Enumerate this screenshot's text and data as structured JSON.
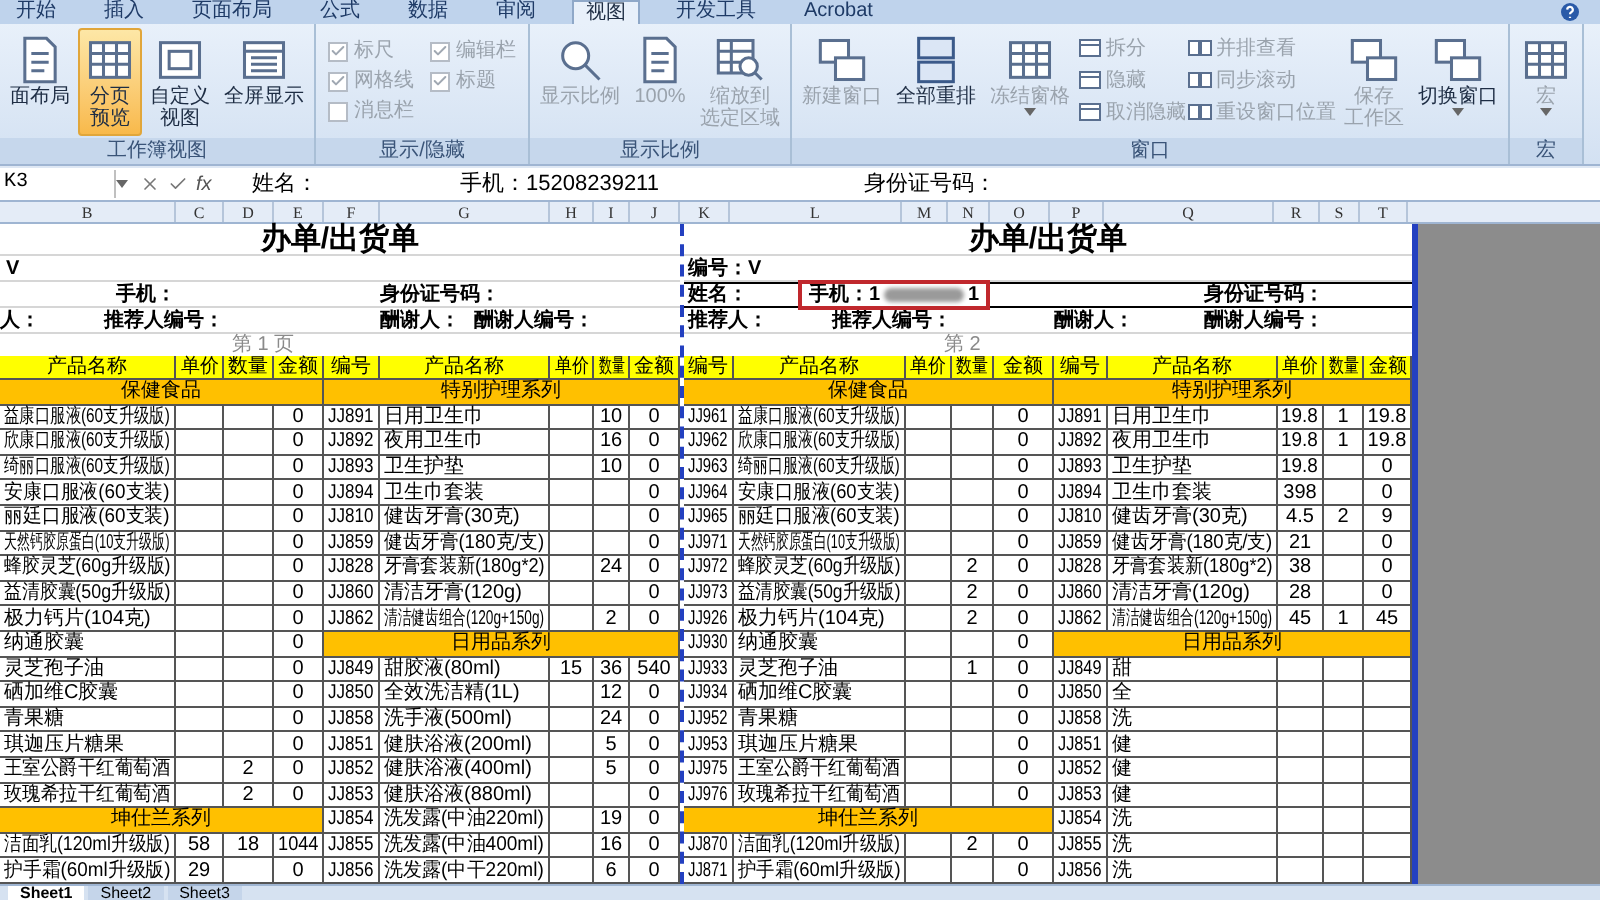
{
  "ribbon": {
    "tabs": [
      {
        "label": "开始",
        "selected": false
      },
      {
        "label": "插入",
        "selected": false
      },
      {
        "label": "页面布局",
        "selected": false
      },
      {
        "label": "公式",
        "selected": false
      },
      {
        "label": "数据",
        "selected": false
      },
      {
        "label": "审阅",
        "selected": false
      },
      {
        "label": "视图",
        "selected": true
      },
      {
        "label": "开发工具",
        "selected": false
      },
      {
        "label": "Acrobat",
        "selected": false
      }
    ],
    "groups": [
      {
        "label": "工作簿视图",
        "items": [
          {
            "kind": "large",
            "lines": [
              "面布局"
            ],
            "selected": false,
            "disabled": false,
            "dropdown": false
          },
          {
            "kind": "large",
            "lines": [
              "分页",
              "预览"
            ],
            "selected": true,
            "disabled": false,
            "dropdown": false
          },
          {
            "kind": "large",
            "lines": [
              "自定义",
              "视图"
            ],
            "selected": false,
            "disabled": false,
            "dropdown": false
          },
          {
            "kind": "large",
            "lines": [
              "全屏显示"
            ],
            "selected": false,
            "disabled": false,
            "dropdown": false
          }
        ]
      },
      {
        "label": "显示/隐藏",
        "items": [
          {
            "kind": "check",
            "label": "标尺",
            "checked": true,
            "disabled": true
          },
          {
            "kind": "check",
            "label": "编辑栏",
            "checked": true,
            "disabled": true
          },
          {
            "kind": "check",
            "label": "网格线",
            "checked": true,
            "disabled": true
          },
          {
            "kind": "check",
            "label": "标题",
            "checked": true,
            "disabled": true
          },
          {
            "kind": "check",
            "label": "消息栏",
            "checked": false,
            "disabled": true
          }
        ]
      },
      {
        "label": "显示比例",
        "items": [
          {
            "kind": "large",
            "lines": [
              "显示比例"
            ],
            "disabled": true,
            "dropdown": false
          },
          {
            "kind": "large",
            "lines": [
              "100%"
            ],
            "disabled": true,
            "dropdown": false
          },
          {
            "kind": "large",
            "lines": [
              "缩放到",
              "选定区域"
            ],
            "disabled": true,
            "dropdown": false
          }
        ]
      },
      {
        "label": "窗口",
        "items": [
          {
            "kind": "large",
            "lines": [
              "新建窗口"
            ],
            "disabled": true,
            "dropdown": false
          },
          {
            "kind": "large",
            "lines": [
              "全部重排"
            ],
            "disabled": false,
            "dropdown": false
          },
          {
            "kind": "large",
            "lines": [
              "冻结窗格"
            ],
            "disabled": true,
            "dropdown": true
          },
          {
            "kind": "small",
            "label": "拆分",
            "disabled": true
          },
          {
            "kind": "small",
            "label": "隐藏",
            "disabled": true
          },
          {
            "kind": "small",
            "label": "取消隐藏",
            "disabled": true
          },
          {
            "kind": "small",
            "label": "并排查看",
            "disabled": true
          },
          {
            "kind": "small",
            "label": "同步滚动",
            "disabled": true
          },
          {
            "kind": "small",
            "label": "重设窗口位置",
            "disabled": true
          },
          {
            "kind": "large",
            "lines": [
              "保存",
              "工作区"
            ],
            "disabled": true,
            "dropdown": false
          },
          {
            "kind": "large",
            "lines": [
              "切换窗口"
            ],
            "disabled": false,
            "dropdown": true
          }
        ]
      },
      {
        "label": "宏",
        "items": [
          {
            "kind": "large",
            "lines": [
              "宏"
            ],
            "disabled": true,
            "dropdown": true
          }
        ]
      }
    ]
  },
  "formula_bar": {
    "name_box": "K3",
    "fx": "fx",
    "segments": [
      "姓名：",
      "手机：15208239211",
      "身份证号码："
    ]
  },
  "column_headers": [
    "B",
    "C",
    "D",
    "E",
    "F",
    "G",
    "H",
    "I",
    "J",
    "K",
    "L",
    "M",
    "N",
    "O",
    "P",
    "Q",
    "R",
    "S",
    "T"
  ],
  "pages": [
    {
      "title": "办单/出货单",
      "page_label": "第 1 页",
      "info": [
        {
          "selected": false,
          "segments": [
            {
              "kind": "text",
              "text": "V"
            }
          ]
        },
        {
          "selected": false,
          "segments": [
            {
              "kind": "text",
              "text": "手机："
            },
            {
              "kind": "text",
              "text": "身份证号码："
            }
          ]
        },
        {
          "selected": false,
          "segments": [
            {
              "kind": "text",
              "text": "人："
            },
            {
              "kind": "text",
              "text": "推荐人编号："
            },
            {
              "kind": "text",
              "text": "酬谢人："
            },
            {
              "kind": "text",
              "text": "酬谢人编号："
            }
          ]
        }
      ],
      "tables": [
        {
          "columns": [
            "产品名称",
            "单价",
            "数量",
            "金额"
          ],
          "rows": [
            {
              "kind": "category",
              "text": "保健食品"
            },
            {
              "kind": "item",
              "name": "益康口服液(60支升级版)",
              "amount": "0"
            },
            {
              "kind": "item",
              "name": "欣康口服液(60支升级版)",
              "amount": "0"
            },
            {
              "kind": "item",
              "name": "绮丽口服液(60支升级版)",
              "amount": "0"
            },
            {
              "kind": "item",
              "name": "安康口服液(60支装)",
              "amount": "0"
            },
            {
              "kind": "item",
              "name": "丽廷口服液(60支装)",
              "amount": "0"
            },
            {
              "kind": "item",
              "name": "天然钙胶原蛋白(10支升级版)",
              "amount": "0"
            },
            {
              "kind": "item",
              "name": "蜂胶灵芝(60g升级版)",
              "amount": "0"
            },
            {
              "kind": "item",
              "name": "益清胶囊(50g升级版)",
              "amount": "0"
            },
            {
              "kind": "item",
              "name": "极力钙片(104克)",
              "amount": "0"
            },
            {
              "kind": "item",
              "name": "纳通胶囊",
              "amount": "0"
            },
            {
              "kind": "item",
              "name": "灵芝孢子油",
              "amount": "0"
            },
            {
              "kind": "item",
              "name": "硒加维C胶囊",
              "amount": "0"
            },
            {
              "kind": "item",
              "name": "青果糖",
              "amount": "0"
            },
            {
              "kind": "item",
              "name": "琪迦压片糖果",
              "amount": "0"
            },
            {
              "kind": "item",
              "name": "王室公爵干红葡萄酒",
              "qty": "2",
              "amount": "0"
            },
            {
              "kind": "item",
              "name": "玫瑰希拉干红葡萄酒",
              "qty": "2",
              "amount": "0"
            },
            {
              "kind": "category",
              "text": "坤仕兰系列"
            },
            {
              "kind": "item",
              "name": "洁面乳(120ml升级版)",
              "price": "58",
              "qty": "18",
              "amount": "1044"
            },
            {
              "kind": "item",
              "name": "护手霜(60ml升级版)",
              "price": "29",
              "amount": "0"
            }
          ]
        },
        {
          "columns": [
            "编号",
            "产品名称",
            "单价",
            "数量",
            "金额"
          ],
          "rows": [
            {
              "kind": "category",
              "text": "特别护理系列"
            },
            {
              "kind": "item",
              "code": "JJ891",
              "name": "日用卫生巾",
              "qty": "10",
              "amount": "0"
            },
            {
              "kind": "item",
              "code": "JJ892",
              "name": "夜用卫生巾",
              "qty": "16",
              "amount": "0"
            },
            {
              "kind": "item",
              "code": "JJ893",
              "name": "卫生护垫",
              "qty": "10",
              "amount": "0"
            },
            {
              "kind": "item",
              "code": "JJ894",
              "name": "卫生巾套装",
              "amount": "0"
            },
            {
              "kind": "item",
              "code": "JJ810",
              "name": "健齿牙膏(30克)",
              "amount": "0"
            },
            {
              "kind": "item",
              "code": "JJ859",
              "name": "健齿牙膏(180克/支)",
              "amount": "0"
            },
            {
              "kind": "item",
              "code": "JJ828",
              "name": "牙膏套装新(180g*2)",
              "qty": "24",
              "amount": "0"
            },
            {
              "kind": "item",
              "code": "JJ860",
              "name": "清洁牙膏(120g)",
              "amount": "0"
            },
            {
              "kind": "item",
              "code": "JJ862",
              "name": "清洁健齿组合(120g+150g)",
              "qty": "2",
              "amount": "0"
            },
            {
              "kind": "category",
              "text": "日用品系列"
            },
            {
              "kind": "item",
              "code": "JJ849",
              "name": "甜胶液(80ml)",
              "price": "15",
              "qty": "36",
              "amount": "540"
            },
            {
              "kind": "item",
              "code": "JJ850",
              "name": "全效洗洁精(1L)",
              "qty": "12",
              "amount": "0"
            },
            {
              "kind": "item",
              "code": "JJ858",
              "name": "洗手液(500ml)",
              "qty": "24",
              "amount": "0"
            },
            {
              "kind": "item",
              "code": "JJ851",
              "name": "健肤浴液(200ml)",
              "qty": "5",
              "amount": "0"
            },
            {
              "kind": "item",
              "code": "JJ852",
              "name": "健肤浴液(400ml)",
              "qty": "5",
              "amount": "0"
            },
            {
              "kind": "item",
              "code": "JJ853",
              "name": "健肤浴液(880ml)",
              "amount": "0"
            },
            {
              "kind": "item",
              "code": "JJ854",
              "name": "洗发露(中油220ml)",
              "qty": "19",
              "amount": "0"
            },
            {
              "kind": "item",
              "code": "JJ855",
              "name": "洗发露(中油400ml)",
              "qty": "16",
              "amount": "0"
            },
            {
              "kind": "item",
              "code": "JJ856",
              "name": "洗发露(中干220ml)",
              "qty": "6",
              "amount": "0"
            }
          ]
        }
      ]
    },
    {
      "title": "办单/出货单",
      "page_label": "第 2",
      "info": [
        {
          "selected": false,
          "segments": [
            {
              "kind": "text",
              "text": "编号：V"
            }
          ]
        },
        {
          "selected": true,
          "segments": [
            {
              "kind": "text",
              "text": "姓名："
            },
            {
              "kind": "masked",
              "before": "手机：1",
              "after": "1",
              "highlighted": true
            },
            {
              "kind": "text",
              "text": "身份证号码："
            }
          ]
        },
        {
          "selected": false,
          "segments": [
            {
              "kind": "text",
              "text": "推荐人："
            },
            {
              "kind": "text",
              "text": "推荐人编号："
            },
            {
              "kind": "text",
              "text": "酬谢人："
            },
            {
              "kind": "text",
              "text": "酬谢人编号："
            }
          ]
        }
      ],
      "tables": [
        {
          "columns": [
            "编号",
            "产品名称",
            "单价",
            "数量",
            "金额"
          ],
          "rows": [
            {
              "kind": "category",
              "text": "保健食品"
            },
            {
              "kind": "item",
              "code": "JJ961",
              "name": "益康口服液(60支升级版)",
              "amount": "0"
            },
            {
              "kind": "item",
              "code": "JJ962",
              "name": "欣康口服液(60支升级版)",
              "amount": "0"
            },
            {
              "kind": "item",
              "code": "JJ963",
              "name": "绮丽口服液(60支升级版)",
              "amount": "0"
            },
            {
              "kind": "item",
              "code": "JJ964",
              "name": "安康口服液(60支装)",
              "amount": "0"
            },
            {
              "kind": "item",
              "code": "JJ965",
              "name": "丽廷口服液(60支装)",
              "amount": "0"
            },
            {
              "kind": "item",
              "code": "JJ971",
              "name": "天然钙胶原蛋白(10支升级版)",
              "amount": "0"
            },
            {
              "kind": "item",
              "code": "JJ972",
              "name": "蜂胶灵芝(60g升级版)",
              "qty": "2",
              "amount": "0"
            },
            {
              "kind": "item",
              "code": "JJ973",
              "name": "益清胶囊(50g升级版)",
              "qty": "2",
              "amount": "0"
            },
            {
              "kind": "item",
              "code": "JJ926",
              "name": "极力钙片(104克)",
              "qty": "2",
              "amount": "0"
            },
            {
              "kind": "item",
              "code": "JJ930",
              "name": "纳通胶囊",
              "amount": "0"
            },
            {
              "kind": "item",
              "code": "JJ933",
              "name": "灵芝孢子油",
              "qty": "1",
              "amount": "0"
            },
            {
              "kind": "item",
              "code": "JJ934",
              "name": "硒加维C胶囊",
              "amount": "0"
            },
            {
              "kind": "item",
              "code": "JJ952",
              "name": "青果糖",
              "amount": "0"
            },
            {
              "kind": "item",
              "code": "JJ953",
              "name": "琪迦压片糖果",
              "amount": "0"
            },
            {
              "kind": "item",
              "code": "JJ975",
              "name": "王室公爵干红葡萄酒",
              "amount": "0"
            },
            {
              "kind": "item",
              "code": "JJ976",
              "name": "玫瑰希拉干红葡萄酒",
              "amount": "0"
            },
            {
              "kind": "category",
              "text": "坤仕兰系列"
            },
            {
              "kind": "item",
              "code": "JJ870",
              "name": "洁面乳(120ml升级版)",
              "qty": "2",
              "amount": "0"
            },
            {
              "kind": "item",
              "code": "JJ871",
              "name": "护手霜(60ml升级版)",
              "amount": "0"
            }
          ]
        },
        {
          "columns": [
            "编号",
            "产品名称",
            "单价",
            "数量",
            "金额"
          ],
          "rows": [
            {
              "kind": "category",
              "text": "特别护理系列"
            },
            {
              "kind": "item",
              "code": "JJ891",
              "name": "日用卫生巾",
              "price": "19.8",
              "qty": "1",
              "amount": "19.8"
            },
            {
              "kind": "item",
              "code": "JJ892",
              "name": "夜用卫生巾",
              "price": "19.8",
              "qty": "1",
              "amount": "19.8"
            },
            {
              "kind": "item",
              "code": "JJ893",
              "name": "卫生护垫",
              "price": "19.8",
              "amount": "0"
            },
            {
              "kind": "item",
              "code": "JJ894",
              "name": "卫生巾套装",
              "price": "398",
              "amount": "0"
            },
            {
              "kind": "item",
              "code": "JJ810",
              "name": "健齿牙膏(30克)",
              "price": "4.5",
              "qty": "2",
              "amount": "9"
            },
            {
              "kind": "item",
              "code": "JJ859",
              "name": "健齿牙膏(180克/支)",
              "price": "21",
              "amount": "0"
            },
            {
              "kind": "item",
              "code": "JJ828",
              "name": "牙膏套装新(180g*2)",
              "price": "38",
              "amount": "0"
            },
            {
              "kind": "item",
              "code": "JJ860",
              "name": "清洁牙膏(120g)",
              "price": "28",
              "amount": "0"
            },
            {
              "kind": "item",
              "code": "JJ862",
              "name": "清洁健齿组合(120g+150g)",
              "price": "45",
              "qty": "1",
              "amount": "45"
            },
            {
              "kind": "category",
              "text": "日用品系列"
            },
            {
              "kind": "item",
              "code": "JJ849",
              "name": "甜"
            },
            {
              "kind": "item",
              "code": "JJ850",
              "name": "全"
            },
            {
              "kind": "item",
              "code": "JJ858",
              "name": "洗"
            },
            {
              "kind": "item",
              "code": "JJ851",
              "name": "健"
            },
            {
              "kind": "item",
              "code": "JJ852",
              "name": "健"
            },
            {
              "kind": "item",
              "code": "JJ853",
              "name": "健"
            },
            {
              "kind": "item",
              "code": "JJ854",
              "name": "洗"
            },
            {
              "kind": "item",
              "code": "JJ855",
              "name": "洗"
            },
            {
              "kind": "item",
              "code": "JJ856",
              "name": "洗"
            }
          ]
        }
      ]
    }
  ],
  "sheet_tabs": [
    {
      "label": "Sheet1",
      "selected": true
    },
    {
      "label": "Sheet2",
      "selected": false
    },
    {
      "label": "Sheet3",
      "selected": false
    }
  ]
}
